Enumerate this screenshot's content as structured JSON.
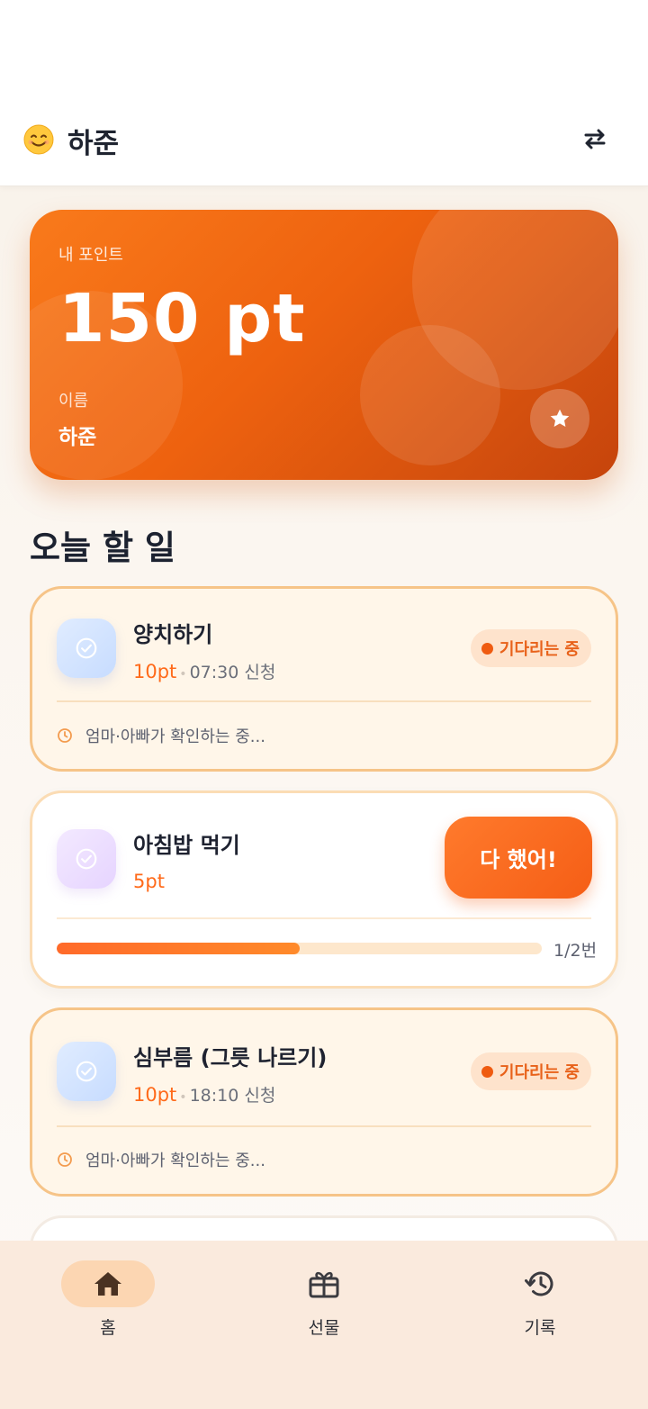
{
  "header": {
    "user_emoji": "😊",
    "user_name": "하준"
  },
  "point_card": {
    "label": "내 포인트",
    "points": "150 pt",
    "name_label": "이름",
    "name": "하준"
  },
  "section_title": "오늘 할 일",
  "tasks": [
    {
      "title": "양치하기",
      "points": "10pt",
      "separator": "•",
      "time": "07:30 신청",
      "badge": "기다리는 중",
      "note": "엄마·아빠가 확인하는 중..."
    },
    {
      "title": "아침밥 먹기",
      "points": "5pt",
      "button": "다 했어!",
      "progress_text": "1/2번",
      "progress_fraction": 0.5
    },
    {
      "title": "심부름 (그릇 나르기)",
      "points": "10pt",
      "separator": "•",
      "time": "18:10 신청",
      "badge": "기다리는 중",
      "note": "엄마·아빠가 확인하는 중..."
    }
  ],
  "bottom_nav": [
    {
      "label": "홈",
      "icon": "home-icon",
      "active": true
    },
    {
      "label": "선물",
      "icon": "gift-icon",
      "active": false
    },
    {
      "label": "기록",
      "icon": "history-icon",
      "active": false
    }
  ],
  "colors": {
    "accent": "#f46a17",
    "pending_border": "#f6c488",
    "badge_bg": "#fee3cc",
    "nav_bg": "#faeadd"
  }
}
